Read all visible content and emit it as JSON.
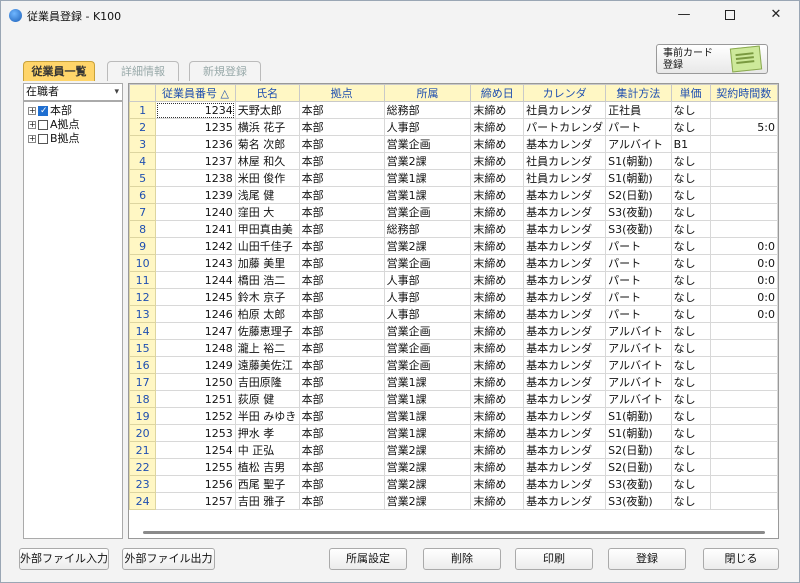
{
  "window": {
    "title": "従業員登録 - K100"
  },
  "tabs": [
    {
      "label": "従業員一覧",
      "active": true
    },
    {
      "label": "詳細情報",
      "active": false
    },
    {
      "label": "新規登録",
      "active": false
    }
  ],
  "prereg_button": {
    "line1": "事前カード",
    "line2": "登録"
  },
  "filter": {
    "value": "在職者"
  },
  "tree": [
    {
      "label": "本部",
      "checked": true
    },
    {
      "label": "A拠点",
      "checked": false
    },
    {
      "label": "B拠点",
      "checked": false
    }
  ],
  "columns": [
    "",
    "従業員番号 △",
    "氏名",
    "拠点",
    "所属",
    "締め日",
    "カレンダ",
    "集計方法",
    "単価",
    "契約時間数"
  ],
  "rows": [
    [
      "1",
      "1234",
      "天野太郎",
      "本部",
      "総務部",
      "末締め",
      "社員カレンダ",
      "正社員",
      "なし",
      ""
    ],
    [
      "2",
      "1235",
      "横浜 花子",
      "本部",
      "人事部",
      "末締め",
      "パートカレンダ",
      "パート",
      "なし",
      "5:0"
    ],
    [
      "3",
      "1236",
      "菊名 次郎",
      "本部",
      "営業企画",
      "末締め",
      "基本カレンダ",
      "アルバイト",
      "B1",
      ""
    ],
    [
      "4",
      "1237",
      "林屋 和久",
      "本部",
      "営業2課",
      "末締め",
      "社員カレンダ",
      "S1(朝勤)",
      "なし",
      ""
    ],
    [
      "5",
      "1238",
      "米田 俊作",
      "本部",
      "営業1課",
      "末締め",
      "社員カレンダ",
      "S1(朝勤)",
      "なし",
      ""
    ],
    [
      "6",
      "1239",
      "浅尾 健",
      "本部",
      "営業1課",
      "末締め",
      "基本カレンダ",
      "S2(日勤)",
      "なし",
      ""
    ],
    [
      "7",
      "1240",
      "窪田 大",
      "本部",
      "営業企画",
      "末締め",
      "基本カレンダ",
      "S3(夜勤)",
      "なし",
      ""
    ],
    [
      "8",
      "1241",
      "甲田真由美",
      "本部",
      "総務部",
      "末締め",
      "基本カレンダ",
      "S3(夜勤)",
      "なし",
      ""
    ],
    [
      "9",
      "1242",
      "山田千佳子",
      "本部",
      "営業2課",
      "末締め",
      "基本カレンダ",
      "パート",
      "なし",
      "0:0"
    ],
    [
      "10",
      "1243",
      "加藤 美里",
      "本部",
      "営業企画",
      "末締め",
      "基本カレンダ",
      "パート",
      "なし",
      "0:0"
    ],
    [
      "11",
      "1244",
      "橋田 浩二",
      "本部",
      "人事部",
      "末締め",
      "基本カレンダ",
      "パート",
      "なし",
      "0:0"
    ],
    [
      "12",
      "1245",
      "鈴木 京子",
      "本部",
      "人事部",
      "末締め",
      "基本カレンダ",
      "パート",
      "なし",
      "0:0"
    ],
    [
      "13",
      "1246",
      "柏原 太郎",
      "本部",
      "人事部",
      "末締め",
      "基本カレンダ",
      "パート",
      "なし",
      "0:0"
    ],
    [
      "14",
      "1247",
      "佐藤恵理子",
      "本部",
      "営業企画",
      "末締め",
      "基本カレンダ",
      "アルバイト",
      "なし",
      ""
    ],
    [
      "15",
      "1248",
      "瀧上 裕二",
      "本部",
      "営業企画",
      "末締め",
      "基本カレンダ",
      "アルバイト",
      "なし",
      ""
    ],
    [
      "16",
      "1249",
      "遠藤美佐江",
      "本部",
      "営業企画",
      "末締め",
      "基本カレンダ",
      "アルバイト",
      "なし",
      ""
    ],
    [
      "17",
      "1250",
      "吉田原隆",
      "本部",
      "営業1課",
      "末締め",
      "基本カレンダ",
      "アルバイト",
      "なし",
      ""
    ],
    [
      "18",
      "1251",
      "荻原 健",
      "本部",
      "営業1課",
      "末締め",
      "基本カレンダ",
      "アルバイト",
      "なし",
      ""
    ],
    [
      "19",
      "1252",
      "半田 みゆき",
      "本部",
      "営業1課",
      "末締め",
      "基本カレンダ",
      "S1(朝勤)",
      "なし",
      ""
    ],
    [
      "20",
      "1253",
      "押水 孝",
      "本部",
      "営業1課",
      "末締め",
      "基本カレンダ",
      "S1(朝勤)",
      "なし",
      ""
    ],
    [
      "21",
      "1254",
      "中 正弘",
      "本部",
      "営業2課",
      "末締め",
      "基本カレンダ",
      "S2(日勤)",
      "なし",
      ""
    ],
    [
      "22",
      "1255",
      "植松 吉男",
      "本部",
      "営業2課",
      "末締め",
      "基本カレンダ",
      "S2(日勤)",
      "なし",
      ""
    ],
    [
      "23",
      "1256",
      "西尾 聖子",
      "本部",
      "営業2課",
      "末締め",
      "基本カレンダ",
      "S3(夜勤)",
      "なし",
      ""
    ],
    [
      "24",
      "1257",
      "吉田 雅子",
      "本部",
      "営業2課",
      "末締め",
      "基本カレンダ",
      "S3(夜勤)",
      "なし",
      ""
    ]
  ],
  "buttons": {
    "import": "外部ファイル入力",
    "export": "外部ファイル出力",
    "dept_settings": "所属設定",
    "delete": "削除",
    "print": "印刷",
    "register": "登録",
    "close": "閉じる"
  },
  "colors": {
    "accent_tab": "#ffd56a",
    "grid_header": "#fff7c4",
    "grid_header_text": "#1f4fb0"
  }
}
